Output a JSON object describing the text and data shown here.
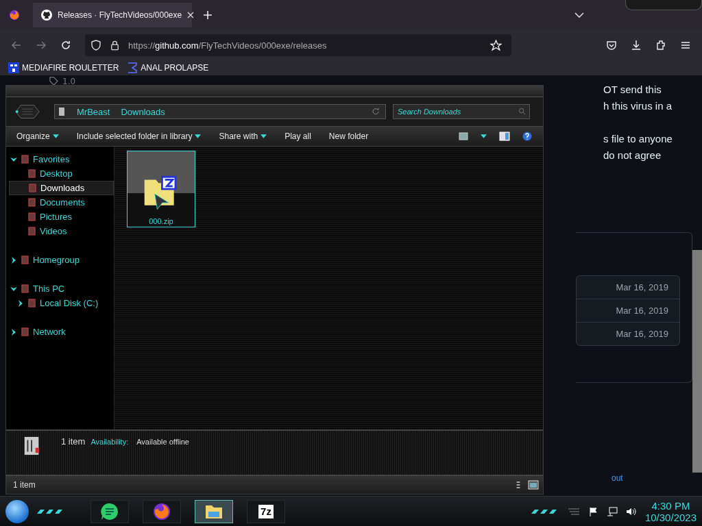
{
  "browser": {
    "tab_title": "Releases · FlyTechVideos/000exe",
    "url": {
      "scheme": "https://",
      "host": "github.com",
      "path": "/FlyTechVideos/000exe/releases"
    },
    "bookmarks": [
      {
        "label": "MEDIAFIRE ROULETTER",
        "kind": "badge"
      },
      {
        "label": "ANAL PROLAPSE",
        "kind": "sigma"
      }
    ]
  },
  "page": {
    "tag": "1.0",
    "paragraphs": [
      [
        "OT send this",
        "h this virus in a"
      ],
      [
        "s file to anyone",
        "do not agree"
      ]
    ],
    "dates": [
      "Mar 16, 2019",
      "Mar 16, 2019",
      "Mar 16, 2019"
    ],
    "footer_link": "out"
  },
  "explorer": {
    "breadcrumb": [
      "MrBeast",
      "Downloads"
    ],
    "search": {
      "placeholder": "Search Downloads"
    },
    "toolbar": [
      {
        "label": "Organize",
        "dropdown": true
      },
      {
        "label": "Include selected folder in library",
        "dropdown": true
      },
      {
        "label": "Share with",
        "dropdown": true
      },
      {
        "label": "Play all",
        "dropdown": false
      },
      {
        "label": "New folder",
        "dropdown": false
      }
    ],
    "nav": [
      {
        "label": "Favorites",
        "expanded": true,
        "selected": false,
        "children": [
          {
            "label": "Desktop",
            "selected": false
          },
          {
            "label": "Downloads",
            "selected": true
          },
          {
            "label": "Documents",
            "selected": false
          },
          {
            "label": "Pictures",
            "selected": false
          },
          {
            "label": "Videos",
            "selected": false
          }
        ]
      },
      {
        "label": "Homegroup",
        "expanded": false,
        "selected": false
      },
      {
        "label": "This PC",
        "expanded": true,
        "selected": false,
        "children": [
          {
            "label": "Local Disk (C:)",
            "expanded": false,
            "selected": false
          }
        ]
      },
      {
        "label": "Network",
        "expanded": false,
        "selected": false
      }
    ],
    "files": [
      {
        "name": "000.zip",
        "selected": true
      }
    ],
    "details": {
      "count": "1 item",
      "availability_label": "Availability:",
      "availability_value": "Available offline"
    },
    "status": "1 item"
  },
  "taskbar": {
    "apps": [
      {
        "kind": "notes",
        "selected": false
      },
      {
        "kind": "firefox",
        "selected": false
      },
      {
        "kind": "explorer",
        "selected": true
      },
      {
        "kind": "archiver",
        "label": "7z",
        "selected": false
      }
    ],
    "time": "4:30 PM",
    "date": "10/30/2023"
  }
}
